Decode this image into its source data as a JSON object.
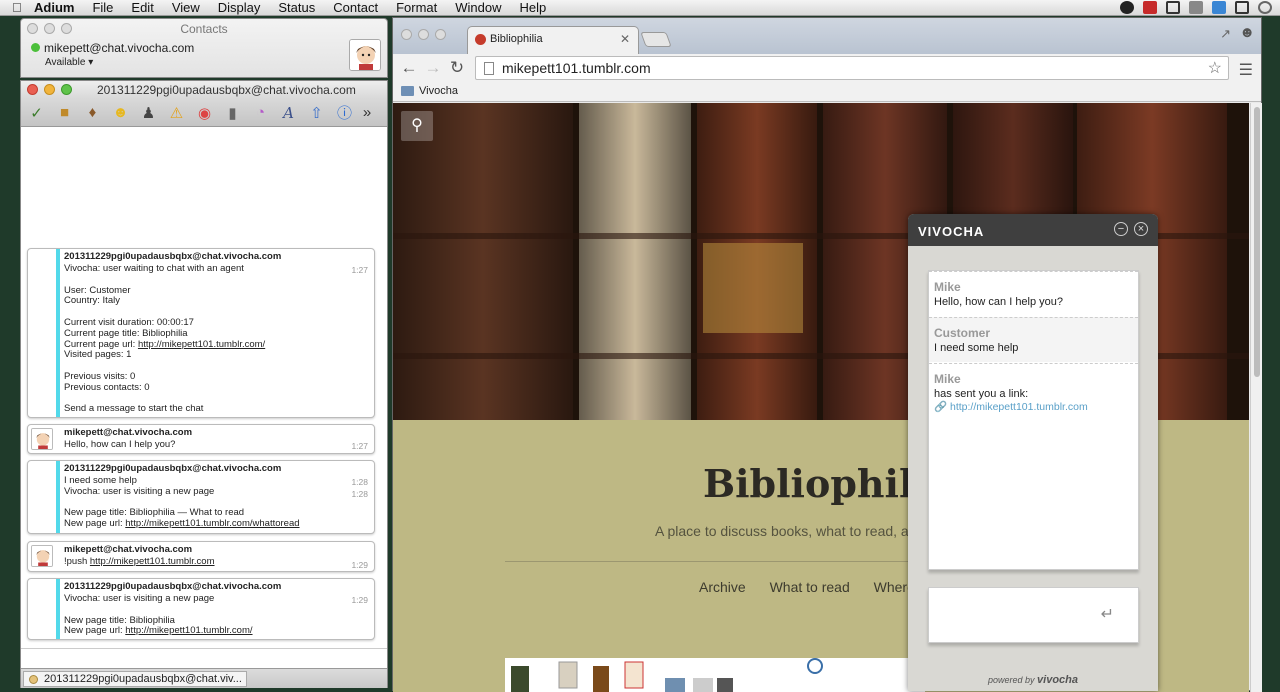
{
  "menubar": {
    "app": "Adium",
    "items": [
      "File",
      "Edit",
      "View",
      "Display",
      "Status",
      "Contact",
      "Format",
      "Window",
      "Help"
    ]
  },
  "contacts": {
    "title": "Contacts",
    "account": "mikepett@chat.vivocha.com",
    "status": "Available"
  },
  "chat": {
    "title": "201311229pgi0upadausbqbx@chat.vivocha.com",
    "messages": [
      {
        "sender": "201311229pgi0upadausbqbx@chat.vivocha.com",
        "line1": "Vivocha: user waiting to chat with an agent",
        "time": "1:27",
        "user": "User: Customer",
        "country": "Country: Italy",
        "duration": "Current visit duration: 00:00:17",
        "page_title": "Current page title: Bibliophilia",
        "page_url_label": "Current page url: ",
        "page_url": "http://mikepett101.tumblr.com/",
        "visited": "Visited pages: 1",
        "prev_visits": "Previous visits: 0",
        "prev_contacts": "Previous contacts: 0",
        "send": "Send a message to start the chat"
      },
      {
        "sender": "mikepett@chat.vivocha.com",
        "text": "Hello, how can I help you?",
        "time": "1:27"
      },
      {
        "sender": "201311229pgi0upadausbqbx@chat.vivocha.com",
        "line1": "I need some help",
        "time1": "1:28",
        "line2": "Vivocha: user is visiting a new page",
        "time2": "1:28",
        "title_line": "New page title: Bibliophilia — What to read",
        "url_label": "New page url: ",
        "url": "http://mikepett101.tumblr.com/whattoread"
      },
      {
        "sender": "mikepett@chat.vivocha.com",
        "text_prefix": "!push ",
        "link": "http://mikepett101.tumblr.com",
        "time": "1:29"
      },
      {
        "sender": "201311229pgi0upadausbqbx@chat.vivocha.com",
        "line1": "Vivocha: user is visiting a new page",
        "time": "1:29",
        "title_line": "New page title: Bibliophilia",
        "url_label": "New page url: ",
        "url": "http://mikepett101.tumblr.com/"
      }
    ],
    "tab_label": "201311229pgi0upadausbqbx@chat.viv..."
  },
  "browser": {
    "tab_title": "Bibliophilia",
    "url": "mikepett101.tumblr.com",
    "bookmark": "Vivocha"
  },
  "blog": {
    "title": "Bibliophili",
    "tagline": "A place to discuss books, what to read, and w",
    "nav": [
      "Archive",
      "What to read",
      "Where to"
    ]
  },
  "vivocha": {
    "header": "VIVOCHA",
    "messages": [
      {
        "who": "Mike",
        "text": "Hello, how can I help you?"
      },
      {
        "who": "Customer",
        "text": "I need some help"
      },
      {
        "who": "Mike",
        "text": "has sent you a link:",
        "link": "http://mikepett101.tumblr.com"
      }
    ],
    "powered_prefix": "powered by",
    "powered_brand": "vivocha"
  },
  "colors": {
    "accent_bar": "#52d9ea",
    "vivocha_header": "#3f3f3f",
    "page_bg": "#beb884"
  }
}
